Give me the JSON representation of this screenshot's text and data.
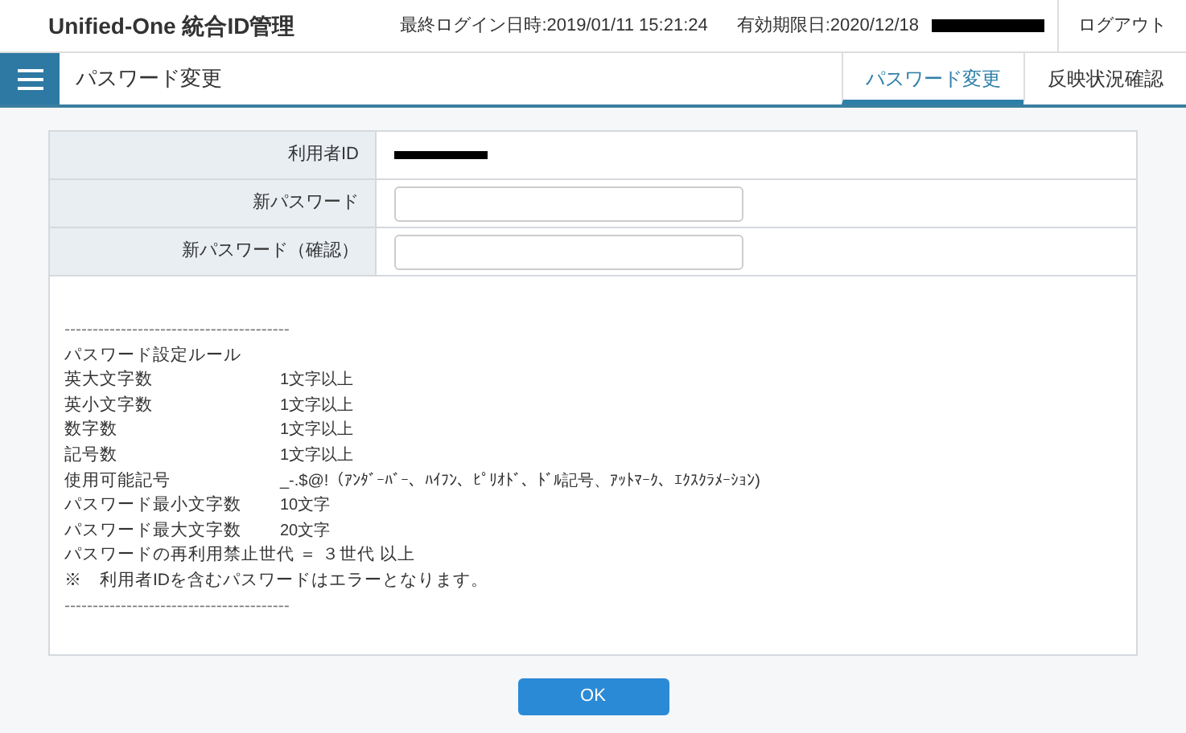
{
  "header": {
    "title": "Unified-One 統合ID管理",
    "last_login": "最終ログイン日時:2019/01/11 15:21:24",
    "expiry": "有効期限日:2020/12/18",
    "logout": "ログアウト"
  },
  "nav": {
    "page_title": "パスワード変更",
    "tabs": [
      {
        "label": "パスワード変更",
        "selected": true
      },
      {
        "label": "反映状況確認",
        "selected": false
      }
    ]
  },
  "form": {
    "rows": [
      {
        "kind": "text",
        "label": "利用者ID"
      },
      {
        "kind": "input",
        "label": "新パスワード"
      },
      {
        "kind": "input",
        "label": "新パスワード（確認）"
      }
    ]
  },
  "rules": {
    "separator_top": "----------------------------------------",
    "heading": "パスワード設定ルール",
    "items": [
      {
        "label": "英大文字数",
        "value": "1文字以上"
      },
      {
        "label": "英小文字数",
        "value": "1文字以上"
      },
      {
        "label": "数字数",
        "value": "1文字以上"
      },
      {
        "label": "記号数",
        "value": "1文字以上"
      },
      {
        "label": "使用可能記号",
        "value": "_-.$@!（ｱﾝﾀﾞｰﾊﾞｰ、ﾊｲﾌﾝ、ﾋﾟﾘｵﾄﾞ、ﾄﾞﾙ記号、ｱｯﾄﾏｰｸ、ｴｸｽｸﾗﾒｰｼｮﾝ)"
      },
      {
        "label": "パスワード最小文字数",
        "value": "10文字"
      },
      {
        "label": "パスワード最大文字数",
        "value": "20文字"
      }
    ],
    "notes": [
      "パスワードの再利用禁止世代 ＝ ３世代 以上",
      "※　利用者IDを含むパスワードはエラーとなります。"
    ],
    "separator_bottom": "----------------------------------------"
  },
  "ok_button": "OK"
}
